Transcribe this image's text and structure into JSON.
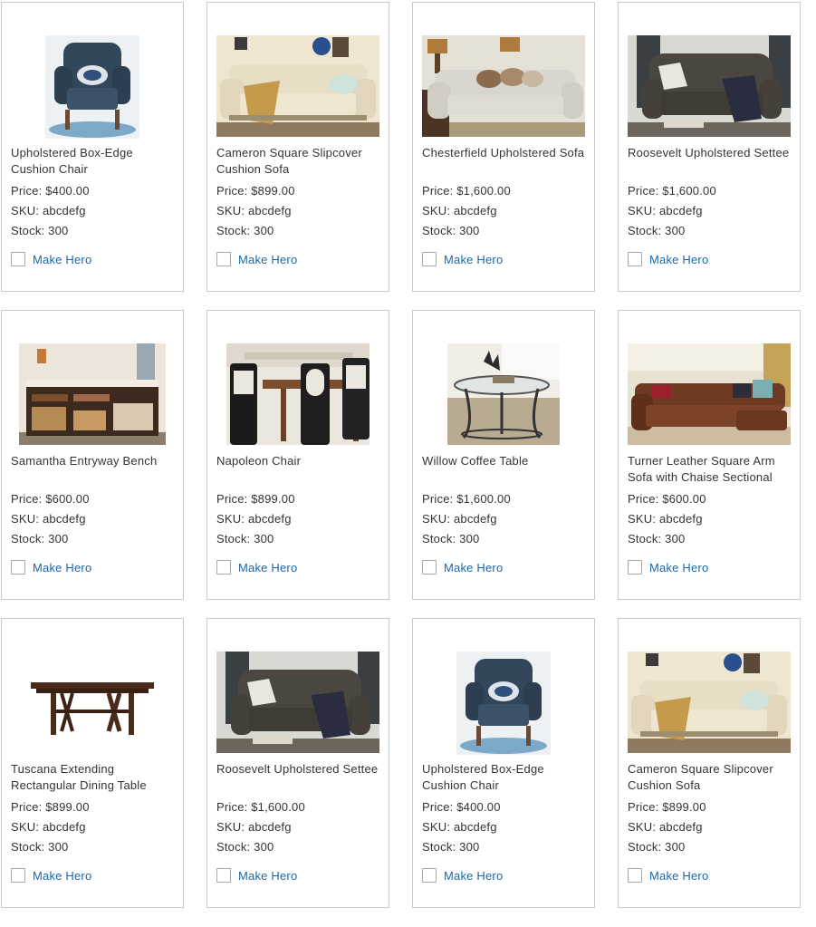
{
  "labels": {
    "price_prefix": "Price: ",
    "sku_prefix": "SKU: ",
    "stock_prefix": "Stock: ",
    "make_hero": "Make Hero"
  },
  "colors": {
    "link": "#1a67a9",
    "border": "#c9c9c9"
  },
  "products": [
    {
      "name": "Upholstered Box-Edge Cushion Chair",
      "price": "$400.00",
      "sku": "abcdefg",
      "stock": "300",
      "image": "wingback-chair",
      "hero_checked": false
    },
    {
      "name": "Cameron Square Slipcover Cushion Sofa",
      "price": "$899.00",
      "sku": "abcdefg",
      "stock": "300",
      "image": "cream-sofa",
      "hero_checked": false
    },
    {
      "name": "Chesterfield Upholstered Sofa",
      "price": "$1,600.00",
      "sku": "abcdefg",
      "stock": "300",
      "image": "chesterfield-sofa",
      "hero_checked": false
    },
    {
      "name": "Roosevelt Upholstered Settee",
      "price": "$1,600.00",
      "sku": "abcdefg",
      "stock": "300",
      "image": "tufted-settee",
      "hero_checked": false
    },
    {
      "name": "Samantha Entryway Bench",
      "price": "$600.00",
      "sku": "abcdefg",
      "stock": "300",
      "image": "entryway-bench",
      "hero_checked": false
    },
    {
      "name": "Napoleon Chair",
      "price": "$899.00",
      "sku": "abcdefg",
      "stock": "300",
      "image": "dining-chairs",
      "hero_checked": false
    },
    {
      "name": "Willow Coffee Table",
      "price": "$1,600.00",
      "sku": "abcdefg",
      "stock": "300",
      "image": "coffee-table",
      "hero_checked": false
    },
    {
      "name": "Turner Leather Square Arm Sofa with Chaise Sectional",
      "price": "$600.00",
      "sku": "abcdefg",
      "stock": "300",
      "image": "leather-sectional",
      "hero_checked": false
    },
    {
      "name": "Tuscana Extending Rectangular Dining Table",
      "price": "$899.00",
      "sku": "abcdefg",
      "stock": "300",
      "image": "dining-table",
      "hero_checked": false
    },
    {
      "name": "Roosevelt Upholstered Settee",
      "price": "$1,600.00",
      "sku": "abcdefg",
      "stock": "300",
      "image": "tufted-settee",
      "hero_checked": false
    },
    {
      "name": "Upholstered Box-Edge Cushion Chair",
      "price": "$400.00",
      "sku": "abcdefg",
      "stock": "300",
      "image": "wingback-chair",
      "hero_checked": false
    },
    {
      "name": "Cameron Square Slipcover Cushion Sofa",
      "price": "$899.00",
      "sku": "abcdefg",
      "stock": "300",
      "image": "cream-sofa",
      "hero_checked": false
    }
  ]
}
